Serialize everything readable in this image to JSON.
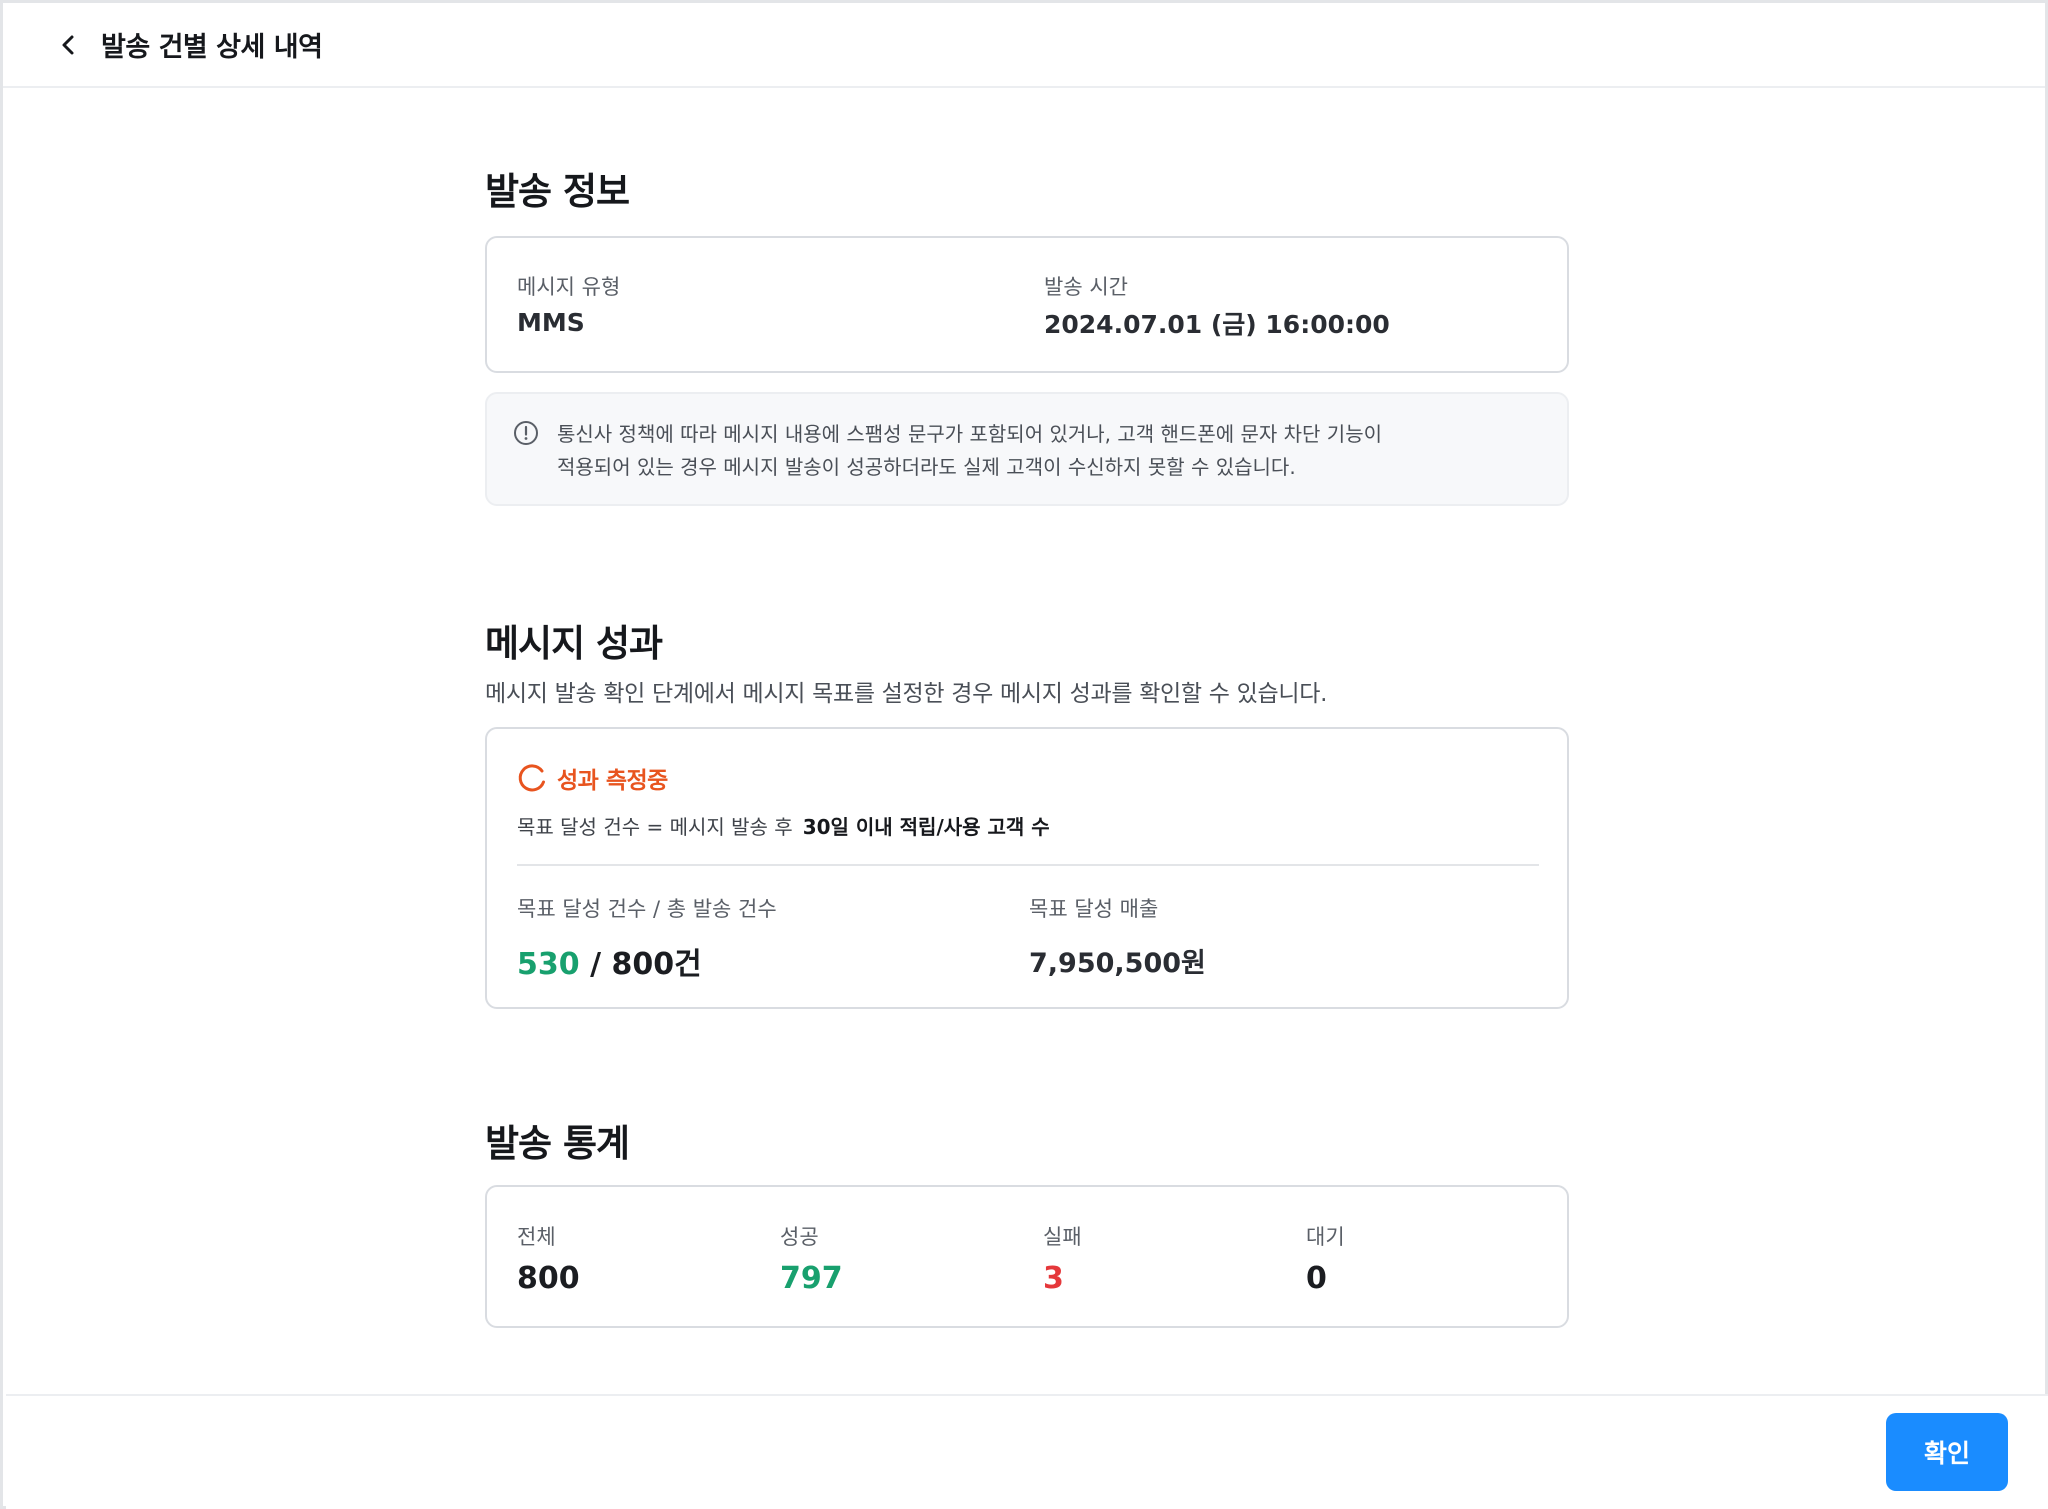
{
  "header": {
    "title": "발송 건별 상세 내역"
  },
  "send_info": {
    "title": "발송 정보",
    "message_type_label": "메시지 유형",
    "message_type_value": "MMS",
    "send_time_label": "발송 시간",
    "send_time_value": "2024.07.01 (금) 16:00:00"
  },
  "notice": {
    "line1": "통신사 정책에 따라 메시지 내용에 스팸성 문구가 포함되어 있거나, 고객 핸드폰에 문자 차단 기능이",
    "line2": "적용되어 있는 경우 메시지 발송이 성공하더라도 실제 고객이 수신하지 못할 수 있습니다."
  },
  "performance": {
    "title": "메시지 성과",
    "description": "메시지 발송 확인 단계에서 메시지 목표를 설정한 경우 메시지 성과를 확인할 수 있습니다.",
    "status": "성과 측정중",
    "formula_prefix": "목표 달성 건수 =  메시지 발송 후",
    "formula_strong": "30일 이내 적립/사용 고객 수",
    "achieved_label": "목표 달성 건수 / 총 발송 건수",
    "achieved_value": "530",
    "total_value": "/ 800건",
    "revenue_label": "목표 달성 매출",
    "revenue_value": "7,950,500원",
    "accent_color": "#e8541f",
    "success_color": "#18a06e"
  },
  "stats": {
    "title": "발송 통계",
    "total_label": "전체",
    "total_value": "800",
    "success_label": "성공",
    "success_value": "797",
    "fail_label": "실패",
    "fail_value": "3",
    "pending_label": "대기",
    "pending_value": "0",
    "fail_color": "#e5383b"
  },
  "footer": {
    "confirm_label": "확인",
    "confirm_color": "#1a8cff"
  }
}
